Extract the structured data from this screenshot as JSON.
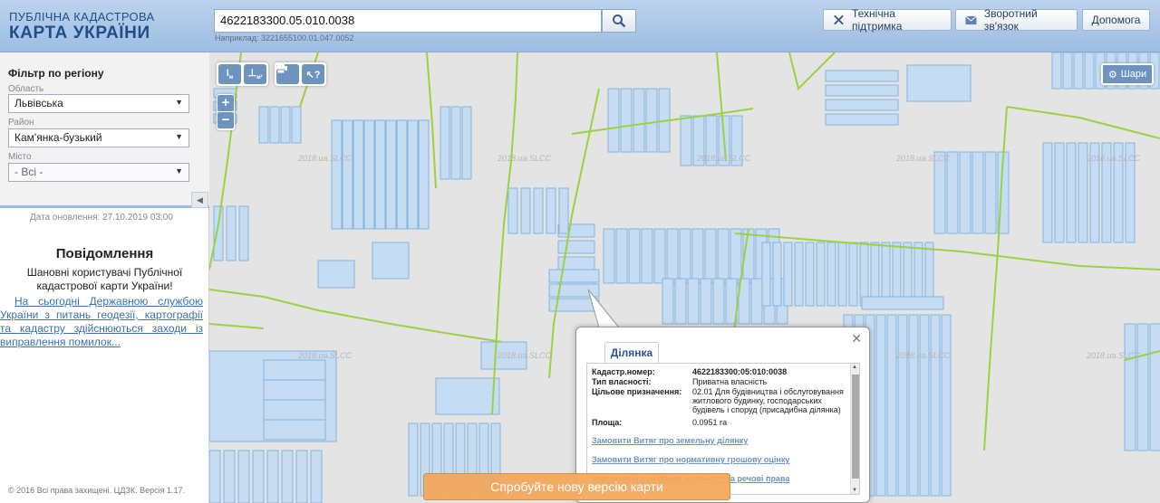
{
  "header": {
    "logo_line1": "ПУБЛІЧНА КАДАСТРОВА",
    "logo_line2": "КАРТА УКРАЇНИ",
    "search_value": "4622183300.05.010.0038",
    "search_hint": "Наприклад: 3221655100.01.047.0052",
    "support_label": "Технічна підтримка",
    "feedback_label": "Зворотний зв'язок",
    "help_label": "Допомога"
  },
  "filter": {
    "title": "Фільтр по регіону",
    "region_label": "Область",
    "region_value": "Львівська",
    "district_label": "Район",
    "district_value": "Кам'янка-бузький",
    "city_label": "Місто",
    "city_value": "- Всі -",
    "updated": "Дата оновлення: 27.10.2019 03:00"
  },
  "notice": {
    "title": "Повідомлення",
    "text": "Шановні користувачі Публічної кадастрової карти України!",
    "link": "На сьогодні Державною службою України з питань геодезії, картографії та кадастру здійснюються заходи із виправлення помилок..."
  },
  "copyright": "© 2016 Всі права захищені. ЦДЗК. Версія 1.17.",
  "map": {
    "layers_label": "Шари",
    "watermark": "2018.ua.SLCC"
  },
  "popup": {
    "tab": "Ділянка",
    "cadastral_label": "Кадастр.номер:",
    "cadastral_value": "4622183300:05:010:0038",
    "ownership_label": "Тип власності:",
    "ownership_value": "Приватна власність",
    "purpose_label": "Цільове призначення:",
    "purpose_value": "02.01 Для будівництва і обслуговування житлового будинку, господарських будівель і споруд (присадибна ділянка)",
    "area_label": "Площа:",
    "area_value": "0.0951 га",
    "link1": "Замовити Витяг про земельну ділянку",
    "link2": "Замовити Витяг про нормативну грошову оцінку",
    "link3": "Інформація про право власності та речові права"
  },
  "try_new": "Спробуйте нову версію карти"
}
